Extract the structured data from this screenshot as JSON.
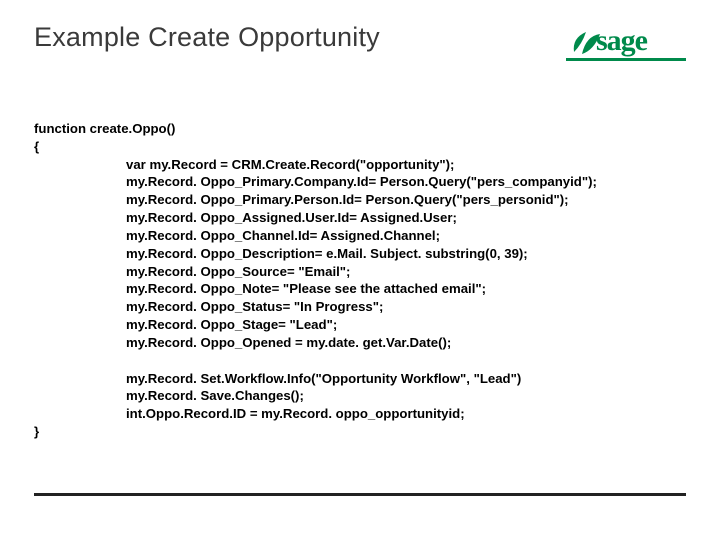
{
  "title": "Example Create Opportunity",
  "logo_text": "sage",
  "code": {
    "decl": "function create.Oppo()",
    "open": "{",
    "lines1": [
      "var my.Record = CRM.Create.Record(\"opportunity\");",
      "my.Record. Oppo_Primary.Company.Id= Person.Query(\"pers_companyid\");",
      "my.Record. Oppo_Primary.Person.Id= Person.Query(\"pers_personid\");",
      "my.Record. Oppo_Assigned.User.Id= Assigned.User;",
      "my.Record. Oppo_Channel.Id= Assigned.Channel;",
      "my.Record. Oppo_Description= e.Mail. Subject. substring(0, 39);",
      "my.Record. Oppo_Source= \"Email\";",
      "my.Record. Oppo_Note= \"Please see the attached email\";",
      "my.Record. Oppo_Status= \"In Progress\";",
      "my.Record. Oppo_Stage= \"Lead\";",
      "my.Record. Oppo_Opened = my.date. get.Var.Date();"
    ],
    "lines2": [
      "my.Record. Set.Workflow.Info(\"Opportunity Workflow\", \"Lead\")",
      "my.Record. Save.Changes();",
      "int.Oppo.Record.ID = my.Record. oppo_opportunityid;"
    ],
    "close": "}"
  }
}
